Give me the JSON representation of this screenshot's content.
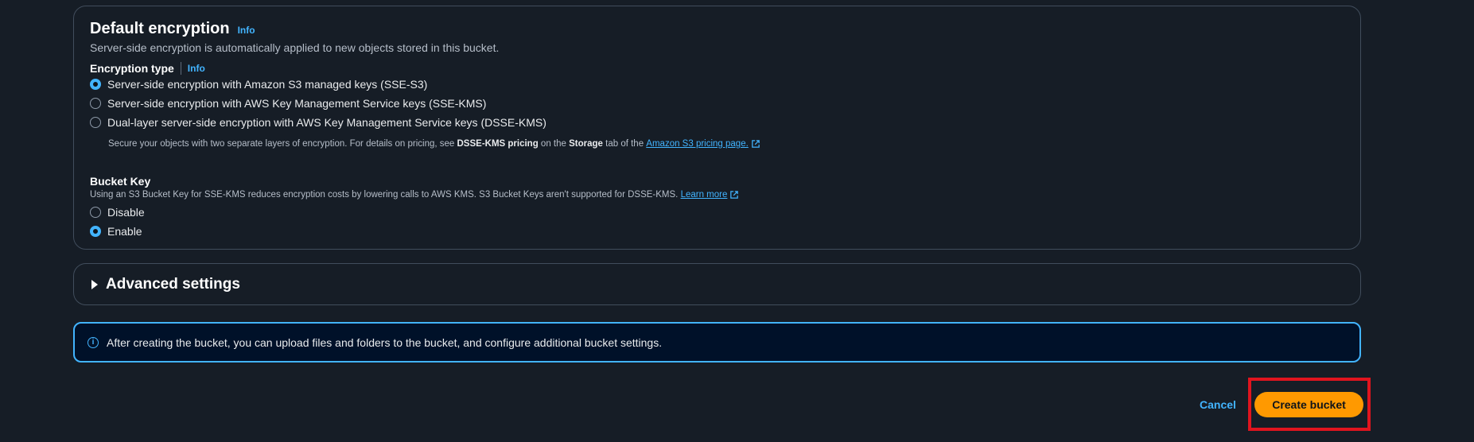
{
  "default_encryption": {
    "title": "Default encryption",
    "info": "Info",
    "description": "Server-side encryption is automatically applied to new objects stored in this bucket.",
    "encryption_type": {
      "label": "Encryption type",
      "info": "Info",
      "options": [
        {
          "label": "Server-side encryption with Amazon S3 managed keys (SSE-S3)",
          "selected": true
        },
        {
          "label": "Server-side encryption with AWS Key Management Service keys (SSE-KMS)",
          "selected": false
        },
        {
          "label": "Dual-layer server-side encryption with AWS Key Management Service keys (DSSE-KMS)",
          "selected": false
        }
      ],
      "dsse_note": {
        "pre": "Secure your objects with two separate layers of encryption. For details on pricing, see ",
        "bold1": "DSSE-KMS pricing",
        "mid": " on the ",
        "bold2": "Storage",
        "post": " tab of the ",
        "link": "Amazon S3 pricing page."
      }
    },
    "bucket_key": {
      "label": "Bucket Key",
      "description": "Using an S3 Bucket Key for SSE-KMS reduces encryption costs by lowering calls to AWS KMS. S3 Bucket Keys aren't supported for DSSE-KMS.",
      "learn_more": "Learn more",
      "options": [
        {
          "label": "Disable",
          "selected": false
        },
        {
          "label": "Enable",
          "selected": true
        }
      ]
    }
  },
  "advanced_settings": {
    "label": "Advanced settings"
  },
  "alert": {
    "icon": "i",
    "text": "After creating the bucket, you can upload files and folders to the bucket, and configure additional bucket settings."
  },
  "actions": {
    "cancel": "Cancel",
    "create": "Create bucket"
  },
  "colors": {
    "background": "#161d26",
    "accent": "#42b4ff",
    "primary_button": "#ff9900",
    "highlight": "#e0141e"
  }
}
